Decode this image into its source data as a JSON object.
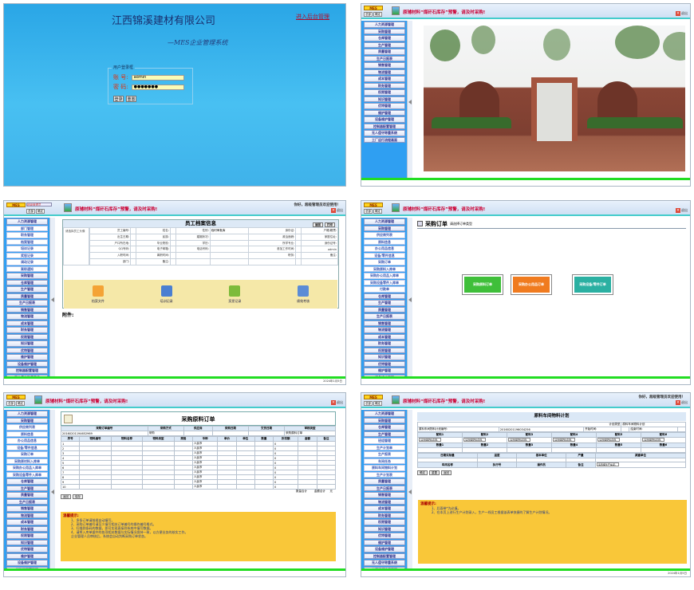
{
  "login": {
    "company": "江西锦溪建材有限公司",
    "top_link": "进入后台管理",
    "subtitle": "—MES企业管理系统",
    "box_title": "用户登录框",
    "user_label": "账 号:",
    "user_value": "admin",
    "pwd_label": "密 码:",
    "pwd_value": "●●●●●●●",
    "btn_login": "登录",
    "btn_reset": "重置"
  },
  "app": {
    "logo": "MES",
    "site_select": "总部",
    "confirm": "确定",
    "marquee": "原辅材料“煤矸石库存”预警，请及时采购!",
    "exit": "退出",
    "welcome": "你好，超级管理员欢迎使用！",
    "uname": "超级管理员",
    "footer": "2024年1月5日",
    "footer_last": "2024年1月5日"
  },
  "menu_main": [
    "人力资源管理",
    "采购管理",
    "仓库管理",
    "生产管理",
    "质量管理",
    "生产日报表",
    "销售管理",
    "物流管理",
    "成本管理",
    "财务管理",
    "权限管理",
    "知识管理",
    "优特管理",
    "维护管理",
    "设备维护管理",
    "控制器配置管理",
    "无人值守称重系统",
    "工厂运行流程画面"
  ],
  "menu_hr_sub": [
    "部门管理",
    "职务管理",
    "档案管理",
    "培训记录",
    "奖惩记录",
    "调动记录",
    "离职通知"
  ],
  "menu_purchase_sub": [
    "供应商列表",
    "原料信息",
    "办公用品信息",
    "设备/零件信息",
    "采购订单",
    "采购原材料入库单",
    "采购办公用品入库单",
    "采购设备零件入库单"
  ],
  "menu_purchase_sub2": [
    "供应商列表",
    "原料信息",
    "办公用品信息",
    "设备/零件信息",
    "采购订单",
    "采购原料入库单",
    "采购办公用品入库单",
    "采购设备零件入库单",
    "付款单"
  ],
  "menu_prod_sub": [
    "班组管理",
    "生产计划单",
    "生产报表",
    "车间任务",
    "原料车间物料计划",
    "生产计划表"
  ],
  "employee": {
    "title": "员工档案信息",
    "btn1": "返回",
    "btn2": "打印",
    "photo_hint": "请选择员工头像",
    "rows": [
      [
        "员工编号:",
        "",
        "姓名:",
        "",
        "性别:",
        "临时审批库",
        "身份证:",
        "",
        "户籍/籍贯:"
      ],
      [
        "出生日期:",
        "",
        "民族:",
        "",
        "婚姻状况:",
        "",
        "政治面貌:",
        "",
        "家庭住址:"
      ],
      [
        "户口所在地:",
        "",
        "毕业院校:",
        "",
        "学历:",
        "",
        "所学专业:",
        "",
        "身份证号:"
      ],
      [
        "QQ号码:",
        "",
        "电子邮箱:",
        "",
        "电话号码:",
        "",
        "参加工作时间:",
        "",
        "admin"
      ],
      [
        "入职时间:",
        "",
        "离职时间:",
        "",
        "",
        "",
        "职务:",
        "",
        "备注:"
      ],
      [
        "部门:",
        "",
        "备注:",
        "",
        "",
        "",
        "",
        "",
        ""
      ]
    ],
    "icons": [
      "档案文件",
      "培训记录",
      "奖惩记录",
      "绩效考核"
    ],
    "attach": "附件:"
  },
  "purchase_choose": {
    "title": "采购订单",
    "hint": "请选择订单类型",
    "btn_raw": "采购原料订单",
    "btn_office": "采购办公用品订单",
    "btn_device": "采购设备/零件订单"
  },
  "raw_order": {
    "title": "采购原料订单",
    "head": [
      "采购订单编号",
      "采购方式",
      "供应商",
      "采购日期",
      "交货日期",
      "审核类型"
    ],
    "head_vals": [
      "20160201194652969",
      "采购",
      "",
      "",
      "",
      "采购原料订单"
    ],
    "cols": [
      "序号",
      "物料编号",
      "物料名称",
      "物料类型",
      "规格",
      "币种",
      "单价",
      "单位",
      "数量",
      "折扣额",
      "金额",
      "备注"
    ],
    "rows": [
      [
        "1",
        "",
        "",
        "",
        "",
        "人民币",
        "",
        "",
        "",
        "0",
        "",
        ""
      ],
      [
        "2",
        "",
        "",
        "",
        "",
        "人民币",
        "",
        "",
        "",
        "0",
        "",
        ""
      ],
      [
        "3",
        "",
        "",
        "",
        "",
        "人民币",
        "",
        "",
        "",
        "0",
        "",
        ""
      ],
      [
        "4",
        "",
        "",
        "",
        "",
        "人民币",
        "",
        "",
        "",
        "0",
        "",
        ""
      ],
      [
        "5",
        "",
        "",
        "",
        "",
        "人民币",
        "",
        "",
        "",
        "0",
        "",
        ""
      ],
      [
        "6",
        "",
        "",
        "",
        "",
        "人民币",
        "",
        "",
        "",
        "0",
        "",
        ""
      ],
      [
        "7",
        "",
        "",
        "",
        "",
        "人民币",
        "",
        "",
        "",
        "0",
        "",
        ""
      ],
      [
        "8",
        "",
        "",
        "",
        "",
        "人民币",
        "",
        "",
        "",
        "0",
        "",
        ""
      ],
      [
        "9",
        "",
        "",
        "",
        "",
        "人民币",
        "",
        "",
        "",
        "0",
        "",
        ""
      ],
      [
        "10",
        "",
        "",
        "",
        "",
        "人民币",
        "",
        "",
        "",
        "0",
        "",
        ""
      ]
    ],
    "total_qty": "数量合计",
    "total_amt": "金额合计",
    "unit": "元",
    "btn_back": "返回",
    "btn_save": "保存",
    "tip_title": "温馨提示:",
    "tips": [
      "1、多条订单请前缀自动填写。",
      "2、采购订单编号请至少填写相关订单编号的操作编号格式。",
      "3、扫描到条码的数据，即可实现直接到系统中填写数据。",
      "4、请将入库单据中的各项相关数据与实际情况保持一致，以方便业务的核实工作。",
      "企业管理人员审核后，系统会自动判断采购订单状态。"
    ]
  },
  "plan_form": {
    "title": "原料车间物料计划",
    "plan_no_label": "原料车间物料计划编号:",
    "plan_no": "20160201196034256",
    "plan_type_label": "计划类型",
    "plan_type": "原料车间物料计划",
    "start_label": "开始时间:",
    "end_label": "结束时间:",
    "mix_labels": [
      "配料1",
      "配料2",
      "配料3",
      "配料4",
      "配料5",
      "配料6"
    ],
    "select_label": "-请选择配料名称-",
    "qty_labels": [
      "数量1",
      "数量2",
      "数量3",
      "数量4",
      "数量5",
      "数量6"
    ],
    "row2": [
      "日期实际量",
      "温度",
      "基本单位",
      "产量",
      "减重单位"
    ],
    "row3": [
      "车间名称",
      "执行号",
      "操作员",
      "备注"
    ],
    "select_dept": "-请选择生产车间-",
    "btns": [
      "确定",
      "重置",
      "返回"
    ],
    "tip_title": "温馨提示:",
    "tips": [
      "1、后面带*为必填。",
      "2、在本页上进行生产计划录入，生产一线员工根据该表单快捷的了解生产计划情况。"
    ]
  },
  "colors": {
    "green": "#3fbf3a",
    "orange": "#f07b1f",
    "teal": "#2bb0a2",
    "blue_side": "#2f9ff2"
  }
}
